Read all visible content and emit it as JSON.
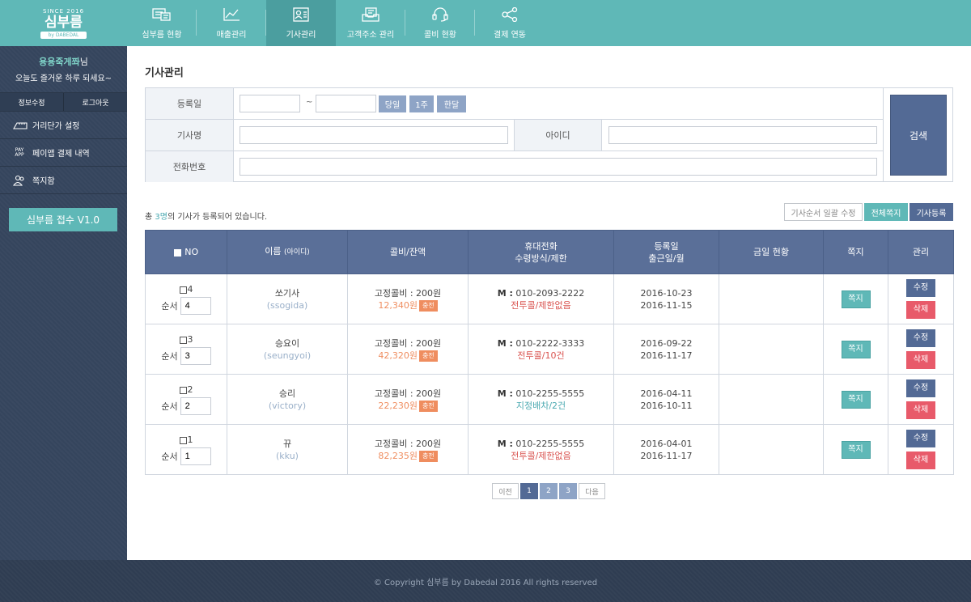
{
  "logo": {
    "since": "SINCE 2016",
    "name": "심부름",
    "sub": "by DABEDAL"
  },
  "nav": [
    {
      "label": "심부름 현황",
      "icon": "errand-status-icon"
    },
    {
      "label": "매출관리",
      "icon": "sales-chart-icon"
    },
    {
      "label": "기사관리",
      "icon": "driver-card-icon",
      "active": true
    },
    {
      "label": "고객주소 관리",
      "icon": "address-book-icon"
    },
    {
      "label": "콜비 현황",
      "icon": "headset-icon"
    },
    {
      "label": "결제 연동",
      "icon": "share-icon"
    }
  ],
  "sidebar": {
    "user_name": "용용죽게쫘",
    "user_suffix": "님",
    "greeting": "오늘도 즐거운 하루 되세요~",
    "account": {
      "edit": "정보수정",
      "logout": "로그아웃"
    },
    "menu": [
      {
        "label": "거리단가 설정",
        "icon": "ruler-icon"
      },
      {
        "label": "페이앱 결제 내역",
        "icon": "payapp-icon",
        "icon_text": "PAY APP"
      },
      {
        "label": "쪽지함",
        "icon": "message-people-icon"
      }
    ],
    "version": "심부름 접수 V1.0"
  },
  "page_title": "기사관리",
  "search": {
    "reg_date_label": "등록일",
    "tilde": "~",
    "today": "당일",
    "week": "1주",
    "month": "한달",
    "driver_name_label": "기사명",
    "id_label": "아이디",
    "phone_label": "전화번호",
    "search_button": "검색"
  },
  "summary": {
    "prefix": "총 ",
    "count": "3명",
    "suffix": "의 기사가 등록되어 있습니다."
  },
  "actions": {
    "bulk_order": "기사순서 일괄 수정",
    "msg_all": "전체쪽지",
    "register": "기사등록"
  },
  "table": {
    "headers": {
      "no": "NO",
      "name": "이름",
      "name_sub": "(아이디)",
      "fee": "콜비/잔액",
      "phone1": "휴대전화",
      "phone2": "수령방식/제한",
      "date1": "등록일",
      "date2": "출근일/월",
      "today": "금일 현황",
      "msg": "쪽지",
      "manage": "관리"
    },
    "order_label": "순서",
    "msg_button": "쪽지",
    "edit_button": "수정",
    "delete_button": "삭제",
    "charge_tag": "충전",
    "m_label": "M :",
    "rows": [
      {
        "no": "4",
        "order": "4",
        "name": "쏘기사",
        "id": "(ssogida)",
        "fee": "고정콜비 : 200원",
        "balance": "12,340원",
        "phone": "010-2093-2222",
        "method": "전투콜/제한없음",
        "method_color": "red",
        "reg": "2016-10-23",
        "work": "2016-11-15",
        "today": ""
      },
      {
        "no": "3",
        "order": "3",
        "name": "승요이",
        "id": "(seungyoi)",
        "fee": "고정콜비 : 200원",
        "balance": "42,320원",
        "phone": "010-2222-3333",
        "method": "전투콜/10건",
        "method_color": "red",
        "reg": "2016-09-22",
        "work": "2016-11-17",
        "today": ""
      },
      {
        "no": "2",
        "order": "2",
        "name": "승리",
        "id": "(victory)",
        "fee": "고정콜비 : 200원",
        "balance": "22,230원",
        "phone": "010-2255-5555",
        "method": "지정배차/2건",
        "method_color": "teal",
        "reg": "2016-04-11",
        "work": "2016-10-11",
        "today": ""
      },
      {
        "no": "1",
        "order": "1",
        "name": "뀨",
        "id": "(kku)",
        "fee": "고정콜비 : 200원",
        "balance": "82,235원",
        "phone": "010-2255-5555",
        "method": "전투콜/제한없음",
        "method_color": "red",
        "reg": "2016-04-01",
        "work": "2016-11-17",
        "today": ""
      }
    ]
  },
  "pagination": {
    "prev": "이전",
    "pages": [
      "1",
      "2",
      "3"
    ],
    "current": "1",
    "next": "다음"
  },
  "footer": "© Copyright 심부름 by Dabedal 2016 All rights reserved",
  "colors": {
    "teal": "#5fb8b7",
    "navy": "#536a95",
    "sidebar": "#35455d",
    "red": "#e85a6a",
    "orange": "#ef8d5f"
  }
}
